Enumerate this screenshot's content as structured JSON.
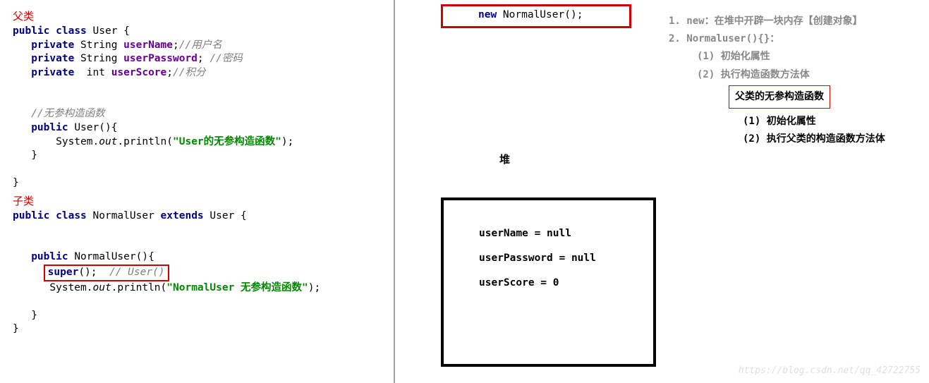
{
  "left": {
    "parentLabel": "父类",
    "childLabel": "子类",
    "code1_l1_a": "public",
    "code1_l1_b": "class",
    "code1_l1_c": " User {",
    "code1_l2_a": "private",
    "code1_l2_b": " String ",
    "code1_l2_c": "userName",
    "code1_l2_d": ";",
    "code1_l2_e": "//用户名",
    "code1_l3_a": "private",
    "code1_l3_b": " String ",
    "code1_l3_c": "userPassword",
    "code1_l3_d": "; ",
    "code1_l3_e": "//密码",
    "code1_l4_a": "private",
    "code1_l4_b": "  int ",
    "code1_l4_c": "userScore",
    "code1_l4_d": ";",
    "code1_l4_e": "//积分",
    "code1_l6": "//无参构造函数",
    "code1_l7_a": "public",
    "code1_l7_b": " User(){",
    "code1_l8_a": "System.",
    "code1_l8_b": "out",
    "code1_l8_c": ".println(",
    "code1_l8_d": "\"User的无参构造函数\"",
    "code1_l8_e": ");",
    "code1_l9": "}",
    "code1_l11": "}",
    "code2_l1_a": "public",
    "code2_l1_b": "class",
    "code2_l1_c": " NormalUser ",
    "code2_l1_d": "extends",
    "code2_l1_e": " User {",
    "code2_l3_a": "public",
    "code2_l3_b": " NormalUser(){",
    "code2_l4_a": "super",
    "code2_l4_b": "();  ",
    "code2_l4_c": "// User()",
    "code2_l5_a": "System.",
    "code2_l5_b": "out",
    "code2_l5_c": ".println(",
    "code2_l5_d": "\"NormalUser 无参构造函数\"",
    "code2_l5_e": ");",
    "code2_l7": "}",
    "code2_l8": "}"
  },
  "topNew": {
    "kw": "new",
    "rest": " NormalUser();"
  },
  "heapLabel": "堆",
  "heap": {
    "l1": "userName = null",
    "l2": "userPassword = null",
    "l3": "userScore = 0"
  },
  "notes": {
    "n1": "1. new：在堆中开辟一块内存【创建对象】",
    "n2": "2. Normaluser(){}：",
    "n2a": "(1) 初始化属性",
    "n2b": "(2)  执行构造函数方法体",
    "redTitle": "父类的无参构造函数",
    "s1": "(1) 初始化属性",
    "s2": "(2) 执行父类的构造函数方法体"
  },
  "watermark": "https://blog.csdn.net/qq_42722755"
}
